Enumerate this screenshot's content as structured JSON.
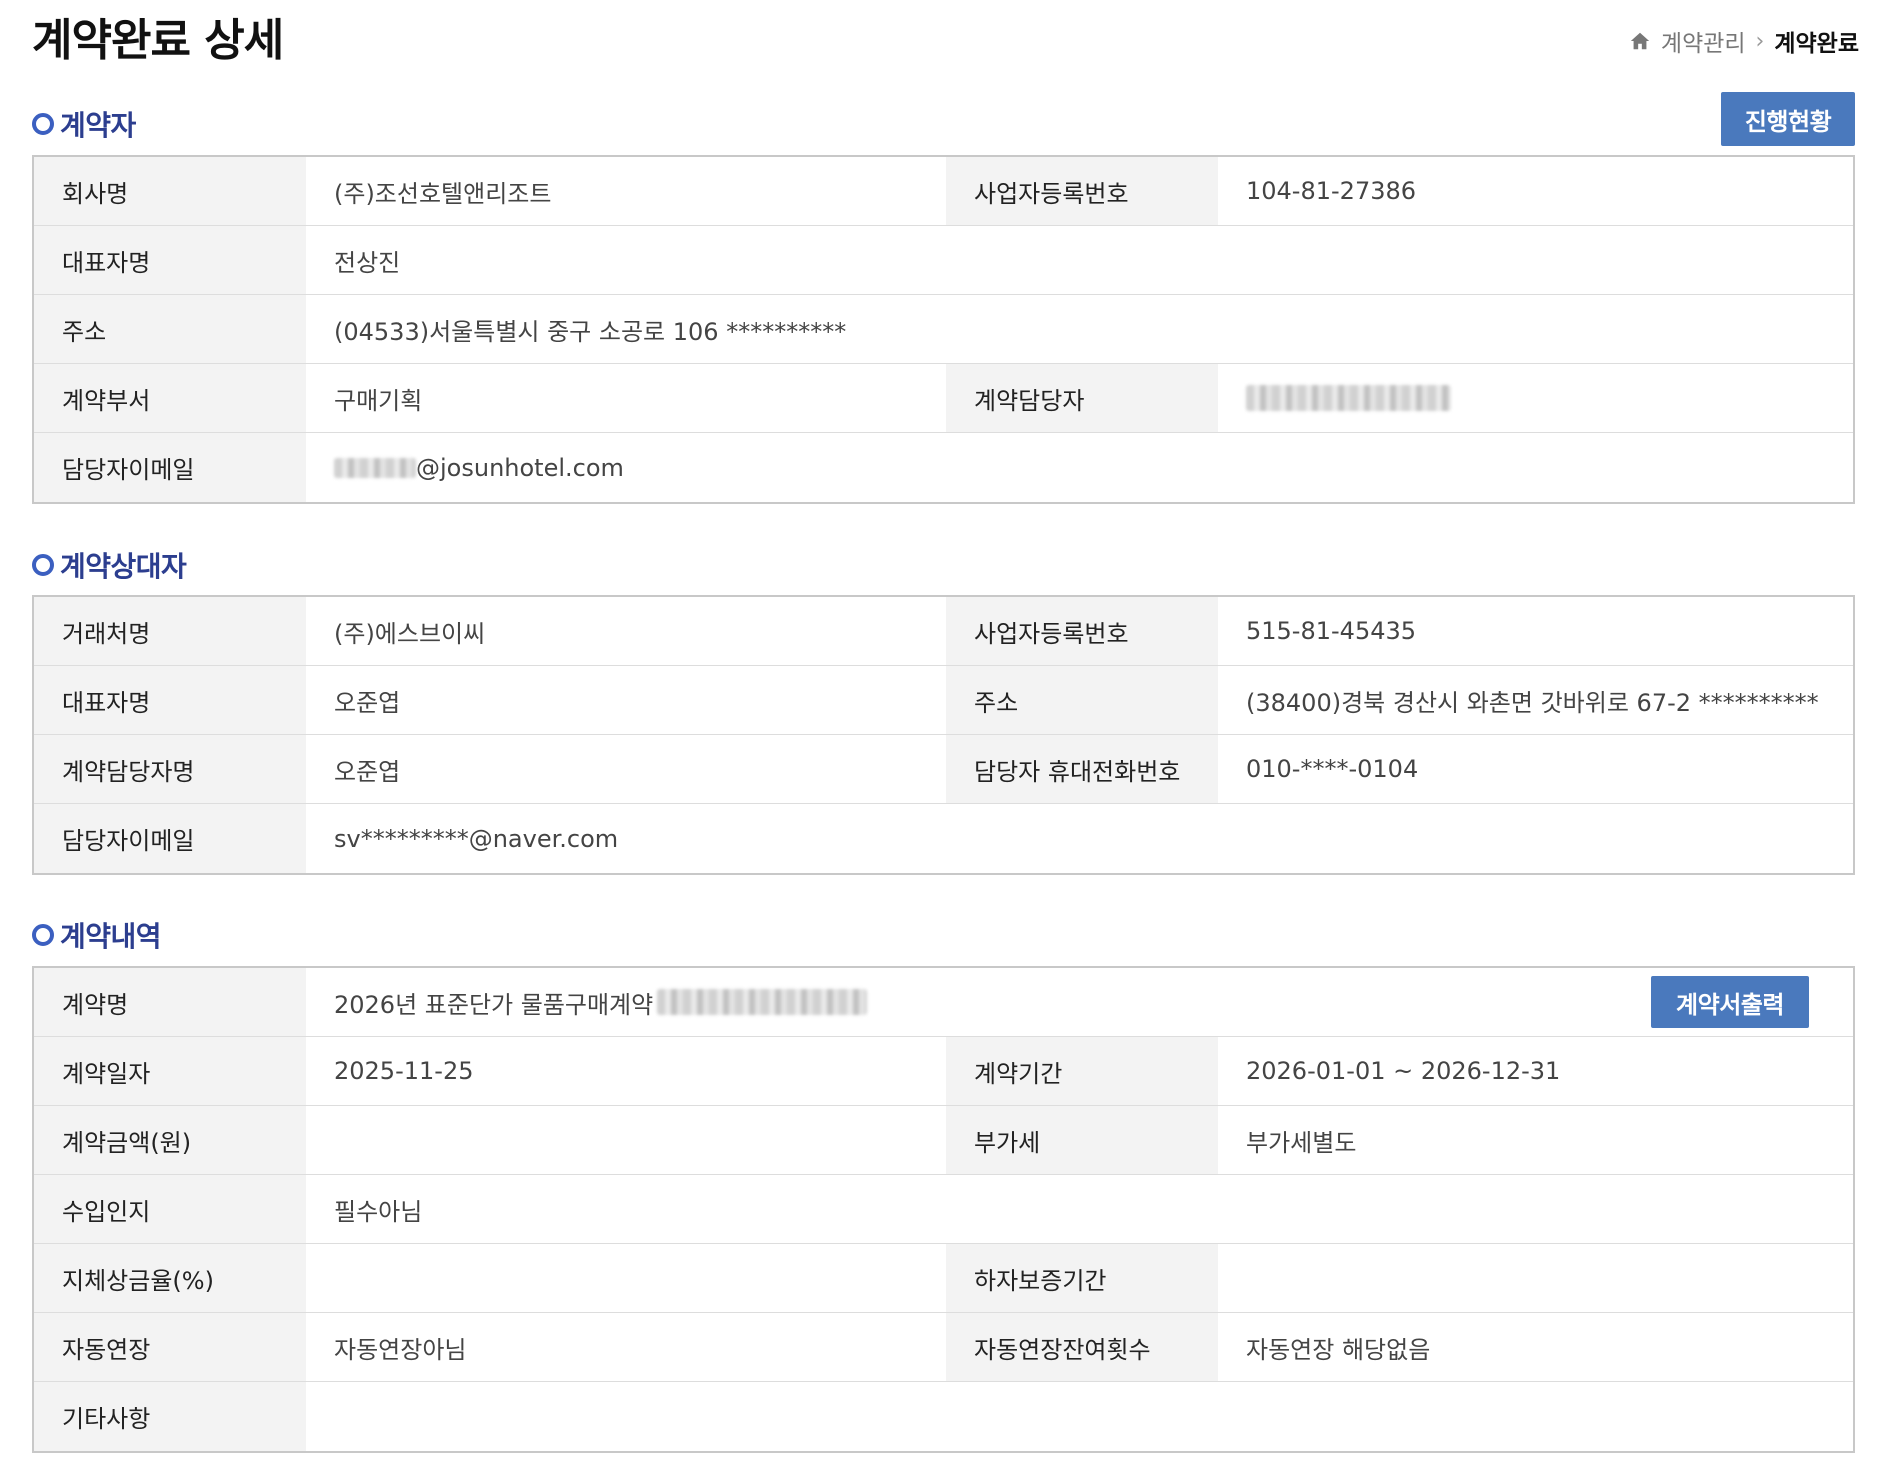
{
  "page": {
    "title": "계약완료 상세",
    "breadcrumb": {
      "parent": "계약관리",
      "current": "계약완료"
    }
  },
  "contractor": {
    "heading": "계약자",
    "progress_button": "진행현황",
    "rows": {
      "company_label": "회사명",
      "company_value": "(주)조선호텔앤리조트",
      "bizno_label": "사업자등록번호",
      "bizno_value": "104-81-27386",
      "ceo_label": "대표자명",
      "ceo_value": "전상진",
      "address_label": "주소",
      "address_value": "(04533)서울특별시 중구 소공로 106 **********",
      "dept_label": "계약부서",
      "dept_value": "구매기획",
      "manager_label": "계약담당자",
      "manager_value": "",
      "email_label": "담당자이메일",
      "email_value": "@josunhotel.com"
    }
  },
  "counterparty": {
    "heading": "계약상대자",
    "rows": {
      "vendor_label": "거래처명",
      "vendor_value": "(주)에스브이씨",
      "bizno_label": "사업자등록번호",
      "bizno_value": "515-81-45435",
      "ceo_label": "대표자명",
      "ceo_value": "오준엽",
      "address_label": "주소",
      "address_value": "(38400)경북 경산시 와촌면 갓바위로 67-2 **********",
      "manager_label": "계약담당자명",
      "manager_value": "오준엽",
      "phone_label": "담당자 휴대전화번호",
      "phone_value": "010-****-0104",
      "email_label": "담당자이메일",
      "email_value": "sv*********@naver.com"
    }
  },
  "contract": {
    "heading": "계약내역",
    "print_button": "계약서출력",
    "rows": {
      "name_label": "계약명",
      "name_value": "2026년 표준단가 물품구매계약",
      "date_label": "계약일자",
      "date_value": "2025-11-25",
      "period_label": "계약기간",
      "period_value": "2026-01-01 ~ 2026-12-31",
      "amount_label": "계약금액(원)",
      "amount_value": "",
      "vat_label": "부가세",
      "vat_value": "부가세별도",
      "stamp_label": "수입인지",
      "stamp_value": "필수아님",
      "penalty_label": "지체상금율(%)",
      "penalty_value": "",
      "warranty_label": "하자보증기간",
      "warranty_value": "",
      "autorenew_label": "자동연장",
      "autorenew_value": "자동연장아님",
      "renewcount_label": "자동연장잔여횟수",
      "renewcount_value": "자동연장 해당없음",
      "etc_label": "기타사항",
      "etc_value": ""
    }
  }
}
